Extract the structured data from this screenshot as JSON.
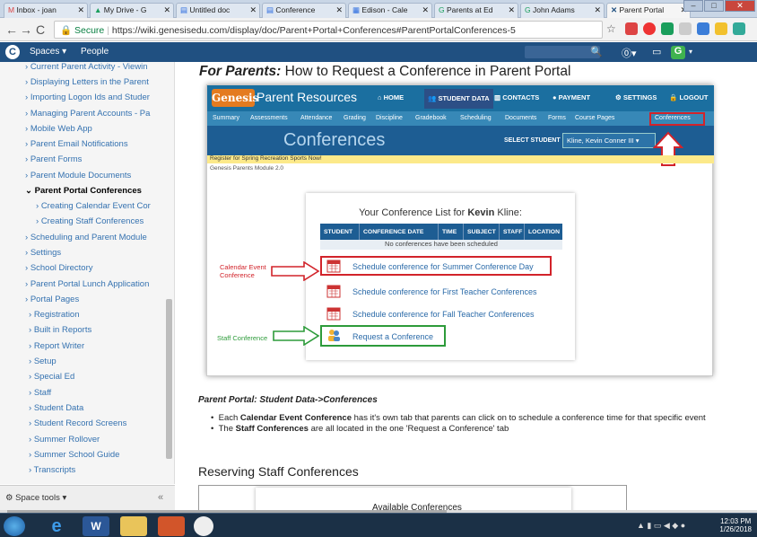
{
  "browser": {
    "tabs": [
      {
        "label": "Inbox - joan"
      },
      {
        "label": "My Drive - G"
      },
      {
        "label": "Untitled doc"
      },
      {
        "label": "Conference"
      },
      {
        "label": "Edison - Cale"
      },
      {
        "label": "Parents at Ed"
      },
      {
        "label": "John Adams"
      },
      {
        "label": "Parent Portal"
      }
    ],
    "url_secure": "Secure",
    "url": "https://wiki.genesisedu.com/display/doc/Parent+Portal+Conferences#ParentPortalConferences-5"
  },
  "confluence": {
    "spaces": "Spaces",
    "people": "People"
  },
  "sidebar": {
    "items": [
      "Current Parent Activity - Viewin",
      "Displaying Letters in the Parent",
      "Importing Logon Ids and Studer",
      "Managing Parent Accounts - Pa",
      "Mobile Web App",
      "Parent Email Notifications",
      "Parent Forms",
      "Parent Module Documents",
      "Parent Portal Conferences",
      "Creating Calendar Event Cor",
      "Creating Staff Conferences",
      "Scheduling and Parent Module",
      "Settings",
      "School Directory",
      "Parent Portal Lunch Application",
      "Portal Pages",
      "Registration",
      "Built in Reports",
      "Report Writer",
      "Setup",
      "Special Ed",
      "Staff",
      "Student Data",
      "Student Record Screens",
      "Summer Rollover",
      "Summer School Guide",
      "Transcripts"
    ],
    "space_tools": "Space tools"
  },
  "page": {
    "title_bold": "For Parents:",
    "title_rest": " How to Request a Conference in Parent Portal",
    "section_heading": "Parent Portal: Student Data->Conferences",
    "bullet1_pre": "Each ",
    "bullet1_bold": "Calendar Event Conference",
    "bullet1_post": " has it's own tab that parents can click on to schedule a conference time for that specific event",
    "bullet2_pre": "The ",
    "bullet2_bold": "Staff Conferences",
    "bullet2_post": " are all located in the one 'Request a Conference' tab",
    "reserving_heading": "Reserving Staff Conferences",
    "available_conferences": "Available Conferences"
  },
  "genesis": {
    "logo": "Genesis",
    "parent_resources": "Parent Resources",
    "nav": [
      "HOME",
      "STUDENT DATA",
      "CONTACTS",
      "PAYMENT",
      "SETTINGS",
      "LOGOUT"
    ],
    "subnav": [
      "Summary",
      "Assessments",
      "Attendance",
      "Grading",
      "Discipline",
      "Gradebook",
      "Scheduling",
      "Documents",
      "Forms",
      "Course Pages",
      "Conferences"
    ],
    "band_title": "Conferences",
    "select_student": "SELECT STUDENT",
    "student": "Kline, Kevin Conner III",
    "banner": "Register for Spring Recreation Sports Now!",
    "module": "Genesis Parents Module 2.0",
    "list_title_pre": "Your Conference List for ",
    "list_title_name": "Kevin",
    "list_title_post": " Kline:",
    "columns": [
      "STUDENT",
      "CONFERENCE DATE",
      "TIME",
      "SUBJECT",
      "STAFF",
      "LOCATION"
    ],
    "empty": "No conferences have been scheduled",
    "links": [
      "Schedule conference for Summer Conference Day",
      "Schedule conference for First Teacher Conferences",
      "Schedule conference for Fall Teacher Conferences",
      "Request a Conference"
    ],
    "annot_calendar": "Calendar Event\nConference",
    "annot_staff": "Staff Conference"
  },
  "taskbar": {
    "time": "12:03 PM",
    "date": "1/26/2018"
  }
}
